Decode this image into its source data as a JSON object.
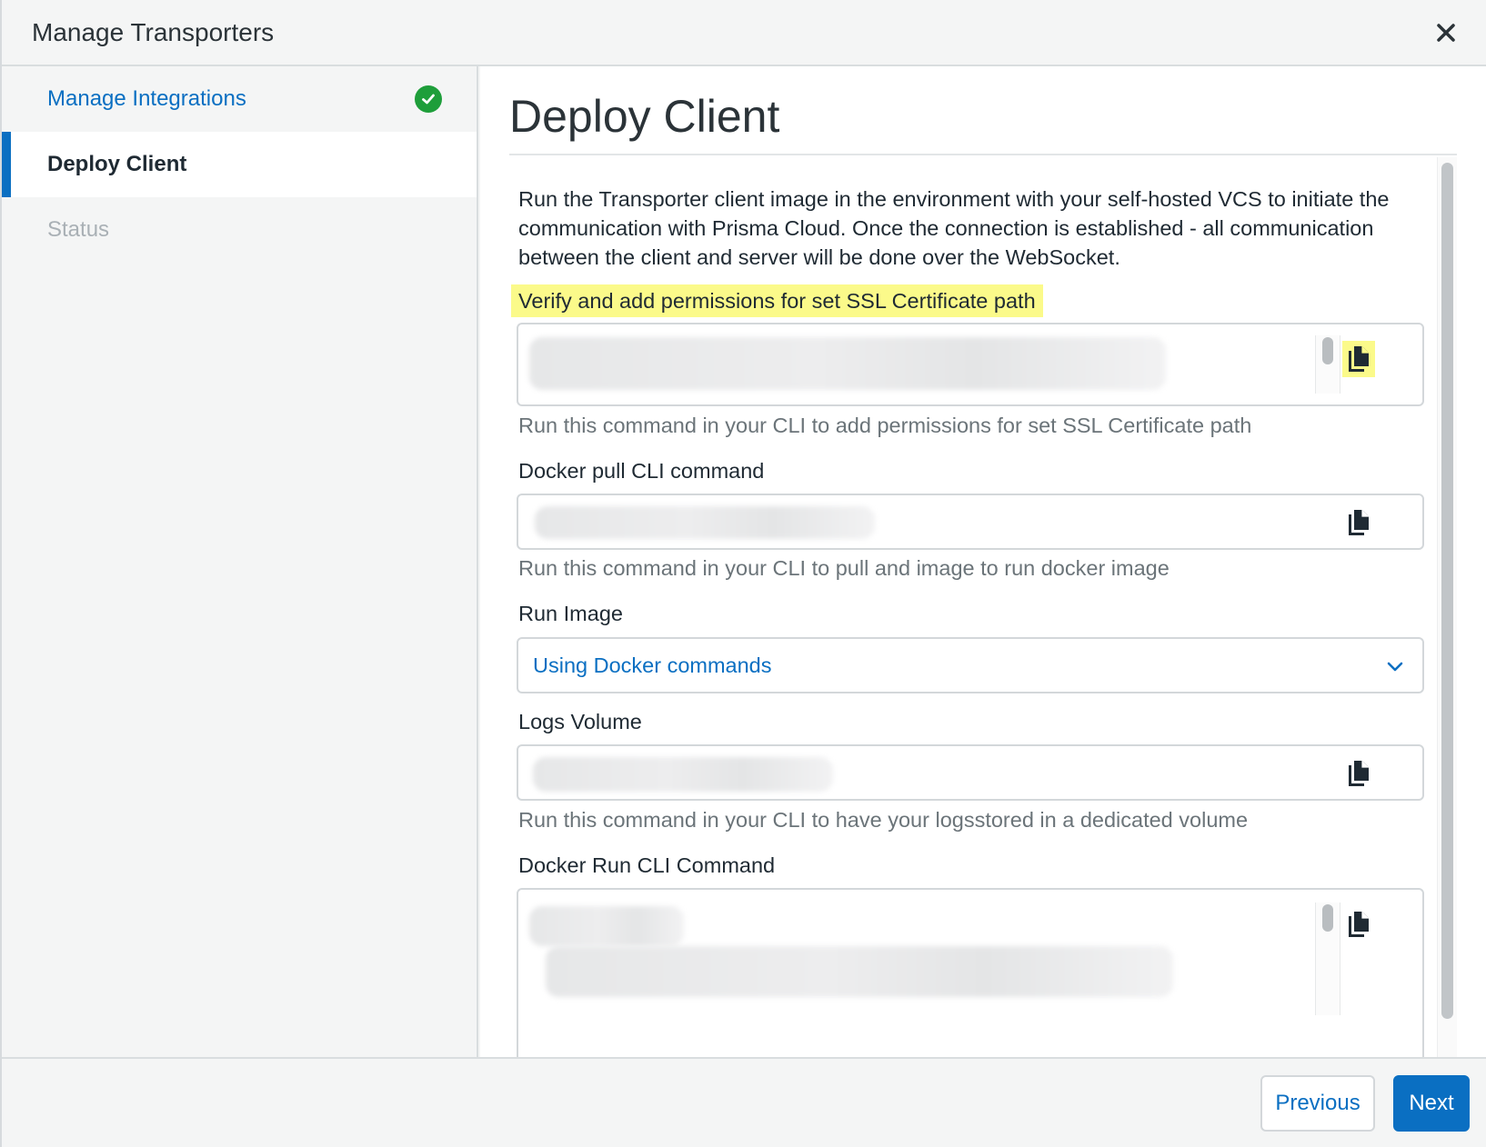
{
  "modal": {
    "title": "Manage Transporters"
  },
  "sidebar": {
    "items": [
      {
        "label": "Manage Integrations",
        "state": "done"
      },
      {
        "label": "Deploy Client",
        "state": "active"
      },
      {
        "label": "Status",
        "state": "disabled"
      }
    ]
  },
  "content": {
    "title": "Deploy Client",
    "description": "Run the Transporter client image in the environment with your self-hosted VCS to initiate the communication with Prisma Cloud. Once the connection is established - all communication between the client and server will be done over the WebSocket.",
    "ssl": {
      "label": "Verify and add permissions for set SSL Certificate path",
      "helper": "Run this command in your CLI to add permissions for set SSL Certificate path"
    },
    "docker_pull": {
      "label": "Docker pull CLI command",
      "helper": "Run this command in your CLI to pull and image to run docker image"
    },
    "run_image": {
      "label": "Run Image",
      "selected": "Using Docker commands"
    },
    "logs_volume": {
      "label": "Logs Volume",
      "helper": "Run this command in your CLI to have your logsstored in a dedicated volume"
    },
    "docker_run": {
      "label": "Docker Run CLI Command"
    }
  },
  "footer": {
    "previous_label": "Previous",
    "next_label": "Next"
  },
  "icons": {
    "close": "close-icon",
    "check": "check-circle-icon",
    "copy": "copy-icon",
    "chevron": "chevron-down-icon"
  },
  "colors": {
    "accent": "#0a6fc2",
    "success": "#1e9e3a",
    "highlight": "#fbfa8a"
  }
}
